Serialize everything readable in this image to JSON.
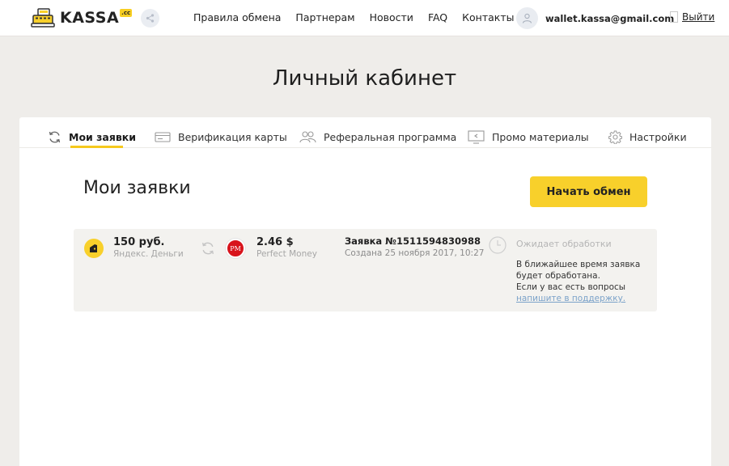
{
  "header": {
    "logo_text": "KASSA",
    "logo_badge": ".cc",
    "nav": [
      "Правила обмена",
      "Партнерам",
      "Новости",
      "FAQ",
      "Контакты"
    ],
    "user_email": "wallet.kassa@gmail.com",
    "logout_label": "Выйти"
  },
  "page_title": "Личный кабинет",
  "tabs": [
    {
      "label": "Мои заявки",
      "icon": "refresh-icon",
      "active": true
    },
    {
      "label": "Верификация карты",
      "icon": "card-icon",
      "active": false
    },
    {
      "label": "Реферальная программа",
      "icon": "users-icon",
      "active": false
    },
    {
      "label": "Промо материалы",
      "icon": "monitor-icon",
      "active": false
    },
    {
      "label": "Настройки",
      "icon": "gear-icon",
      "active": false
    }
  ],
  "section_title": "Мои заявки",
  "start_button": "Начать обмен",
  "order": {
    "from_amount": "150 руб.",
    "from_system": "Яндекс. Деньги",
    "to_amount": "2.46 $",
    "to_system": "Perfect Money",
    "to_icon_text": "PM",
    "number": "Заявка №1511594830988",
    "created": "Создана 25 ноября 2017, 10:27",
    "status": "Ожидает обработки",
    "message_line1": "В ближайшее время заявка",
    "message_line2": "будет обработана.",
    "message_line3": "Если у вас есть вопросы",
    "support_link": "напишите в поддержку."
  },
  "colors": {
    "accent": "#f8d02b",
    "background": "#efedea",
    "link": "#7ba2c9",
    "pm_red": "#d8141c"
  }
}
